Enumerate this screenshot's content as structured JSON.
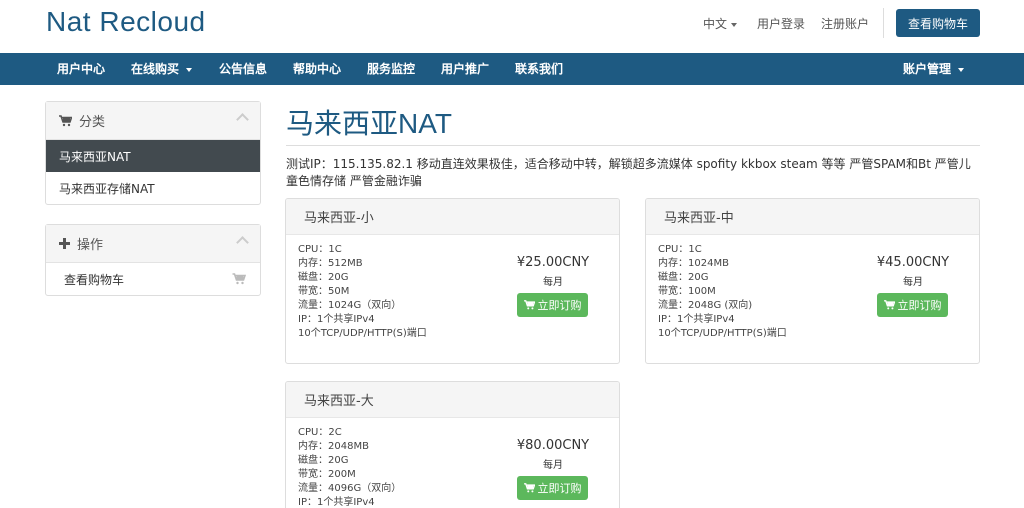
{
  "header": {
    "logo": "Nat Recloud",
    "language": "中文",
    "login": "用户登录",
    "register": "注册账户",
    "cart_button": "查看购物车"
  },
  "nav": {
    "items": [
      "用户中心",
      "在线购买",
      "公告信息",
      "帮助中心",
      "服务监控",
      "用户推广",
      "联系我们"
    ],
    "account": "账户管理"
  },
  "sidebar": {
    "categories": {
      "title": "分类",
      "items": [
        "马来西亚NAT",
        "马来西亚存储NAT"
      ]
    },
    "actions": {
      "title": "操作",
      "items": [
        "查看购物车"
      ]
    }
  },
  "main": {
    "title": "马来西亚NAT",
    "description": "测试IP：115.135.82.1 移动直连效果极佳，适合移动中转，解锁超多流媒体 spofity kkbox steam 等等 严管SPAM和Bt 严管儿童色情存储 严管金融诈骗",
    "products": [
      {
        "name": "马来西亚-小",
        "specs": [
          "CPU：1C",
          "内存：512MB",
          "磁盘：20G",
          "带宽：50M",
          "流量：1024G（双向）",
          "IP：1个共享IPv4",
          "10个TCP/UDP/HTTP(S)端口"
        ],
        "price": "¥25.00CNY",
        "period": "每月",
        "order": "立即订购"
      },
      {
        "name": "马来西亚-中",
        "specs": [
          "CPU：1C",
          "内存：1024MB",
          "磁盘：20G",
          "带宽：100M",
          "流量：2048G (双向)",
          "IP：1个共享IPv4",
          "10个TCP/UDP/HTTP(S)端口"
        ],
        "price": "¥45.00CNY",
        "period": "每月",
        "order": "立即订购"
      },
      {
        "name": "马来西亚-大",
        "specs": [
          "CPU：2C",
          "内存：2048MB",
          "磁盘：20G",
          "带宽：200M",
          "流量：4096G（双向）",
          "IP：1个共享IPv4"
        ],
        "price": "¥80.00CNY",
        "period": "每月",
        "order": "立即订购"
      }
    ]
  },
  "colors": {
    "brand": "#1e5a82",
    "active_side": "#424a4f",
    "order_green": "#5cb85c"
  },
  "icons": [
    "cart-icon",
    "plus-icon",
    "chevron-up-icon",
    "caret-down-icon"
  ]
}
